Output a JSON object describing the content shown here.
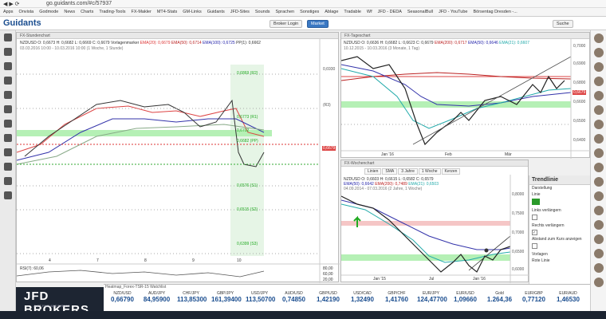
{
  "browser": {
    "url": "go.guidants.com/#c/57937"
  },
  "bookmarks": [
    "Apps",
    "Onvista",
    "Godmode",
    "News",
    "Charts",
    "Trading-Tools",
    "FX-Makler",
    "MT4-Stats",
    "GM-Links",
    "Guidants",
    "JFD-Sites",
    "Sounds",
    "Sprachen",
    "Sonstiges",
    "Ablage",
    "Tradable",
    "Wf",
    "JFD - DEDA",
    "SeasonalBull",
    "JFD - YouTube",
    "Börsentag Dresden -..."
  ],
  "app": {
    "logo": "Guidants",
    "broker_btn": "Broker Login",
    "market_btn": "Market",
    "search": "Suche"
  },
  "panels": {
    "left": {
      "title": "FX-Stundenchart",
      "symbol": "NZDUSD",
      "ohlc": "O: 0,6673  H: 0,6682  L: 0,6669  C: 0,6679",
      "ind1": "Vorlagenmarker",
      "ema20": "EMA(20): 0,6679",
      "ema50": "EMA(50): 0,6714",
      "ema100": "EMA(100): 0,6725",
      "pp": "PP(1): 0,6662",
      "dates": "03.03.2016 10:00 - 10.03.2016 10:00 (1 Woche, 1 Stunde)",
      "yaxis": [
        "0,6930 (R3)",
        "0,6869 (R2)",
        "0,6773 (R1)",
        "0,6702",
        "0,6682 (PP)",
        "0,6679",
        "0,6576 (S1)",
        "0,6515 (S2)",
        "0,6399 (S3)"
      ],
      "xaxis": [
        "4",
        "7",
        "8",
        "9",
        "10"
      ],
      "rsi": "RSI(7): 60,06",
      "rsi_levels": [
        "80,00",
        "60,00",
        "20,00"
      ]
    },
    "tr": {
      "title": "FX-Tageschart",
      "symbol": "NZDUSD",
      "ohlc": "O: 0,6636  H: 0,6682  L: 0,6623  C: 0,6679",
      "ema200": "EMA(200): 0,6717",
      "ema50": "EMA(50): 0,6646",
      "ema21": "EMA(21): 0,6607",
      "dates": "10.12.2015 - 10.03.2016 (3 Monate, 1 Tag)",
      "yaxis": [
        "0,7000",
        "0,6900",
        "0,6800",
        "0,6679",
        "0,6600",
        "0,6500",
        "0,6400"
      ],
      "xaxis": [
        "Jan '16",
        "Feb",
        "Mär"
      ]
    },
    "br": {
      "title": "FX-Wochenchart",
      "symbol": "NZDUSD",
      "ohlc": "O: 0,6603  H: 0,6615  L: 0,6582  C: 0,6579",
      "ema50": "EMA(50): 0,6642",
      "ema200": "EMA(200): 0,7489",
      "ema21": "EMA(21): 0,6503",
      "dates": "04.09.2014 - 07.03.2016 (2 Jahre, 1 Woche)",
      "yaxis": [
        "0,8000",
        "0,7500",
        "0,7000",
        "0,6500",
        "0,6000"
      ],
      "xaxis": [
        "Jan '15",
        "Jul",
        "Jan '16"
      ],
      "toolbar": [
        "Linien",
        "SMA",
        "3 Jahre",
        "1 Woche",
        "Kerzen"
      ]
    }
  },
  "trendline": {
    "title": "Trendlinie",
    "labels": [
      "Darstellung",
      "Linie",
      "Links verlängern",
      "Rechts verlängern",
      "Abstand zum Kurs anzeigen",
      "Vorlagen",
      "Rote Linie"
    ]
  },
  "watchlist": {
    "title": "Heatmap_Forex-TSR-15 Watchlist",
    "items": [
      {
        "n": "NZD/USD",
        "p": "0,66790"
      },
      {
        "n": "AUD/JPY",
        "p": "84,95900"
      },
      {
        "n": "CHF/JPY",
        "p": "113,85300"
      },
      {
        "n": "GBP/JPY",
        "p": "161,39400"
      },
      {
        "n": "USD/JPY",
        "p": "113,50700"
      },
      {
        "n": "AUD/USD",
        "p": "0,74850"
      },
      {
        "n": "GBP/USD",
        "p": "1,42190"
      },
      {
        "n": "USD/CAD",
        "p": "1,32490"
      },
      {
        "n": "GBP/CHF",
        "p": "1,41760"
      },
      {
        "n": "EUR/JPY",
        "p": "124,47700"
      },
      {
        "n": "EUR/USD",
        "p": "1,09660"
      },
      {
        "n": "Gold",
        "p": "1.264,36"
      },
      {
        "n": "EUR/GBP",
        "p": "0,77120"
      },
      {
        "n": "EUR/AUD",
        "p": "1,46530"
      }
    ]
  },
  "broker": {
    "name": "JFD BROKERS",
    "tagline": "JUST FAIR AND DIRECT"
  }
}
